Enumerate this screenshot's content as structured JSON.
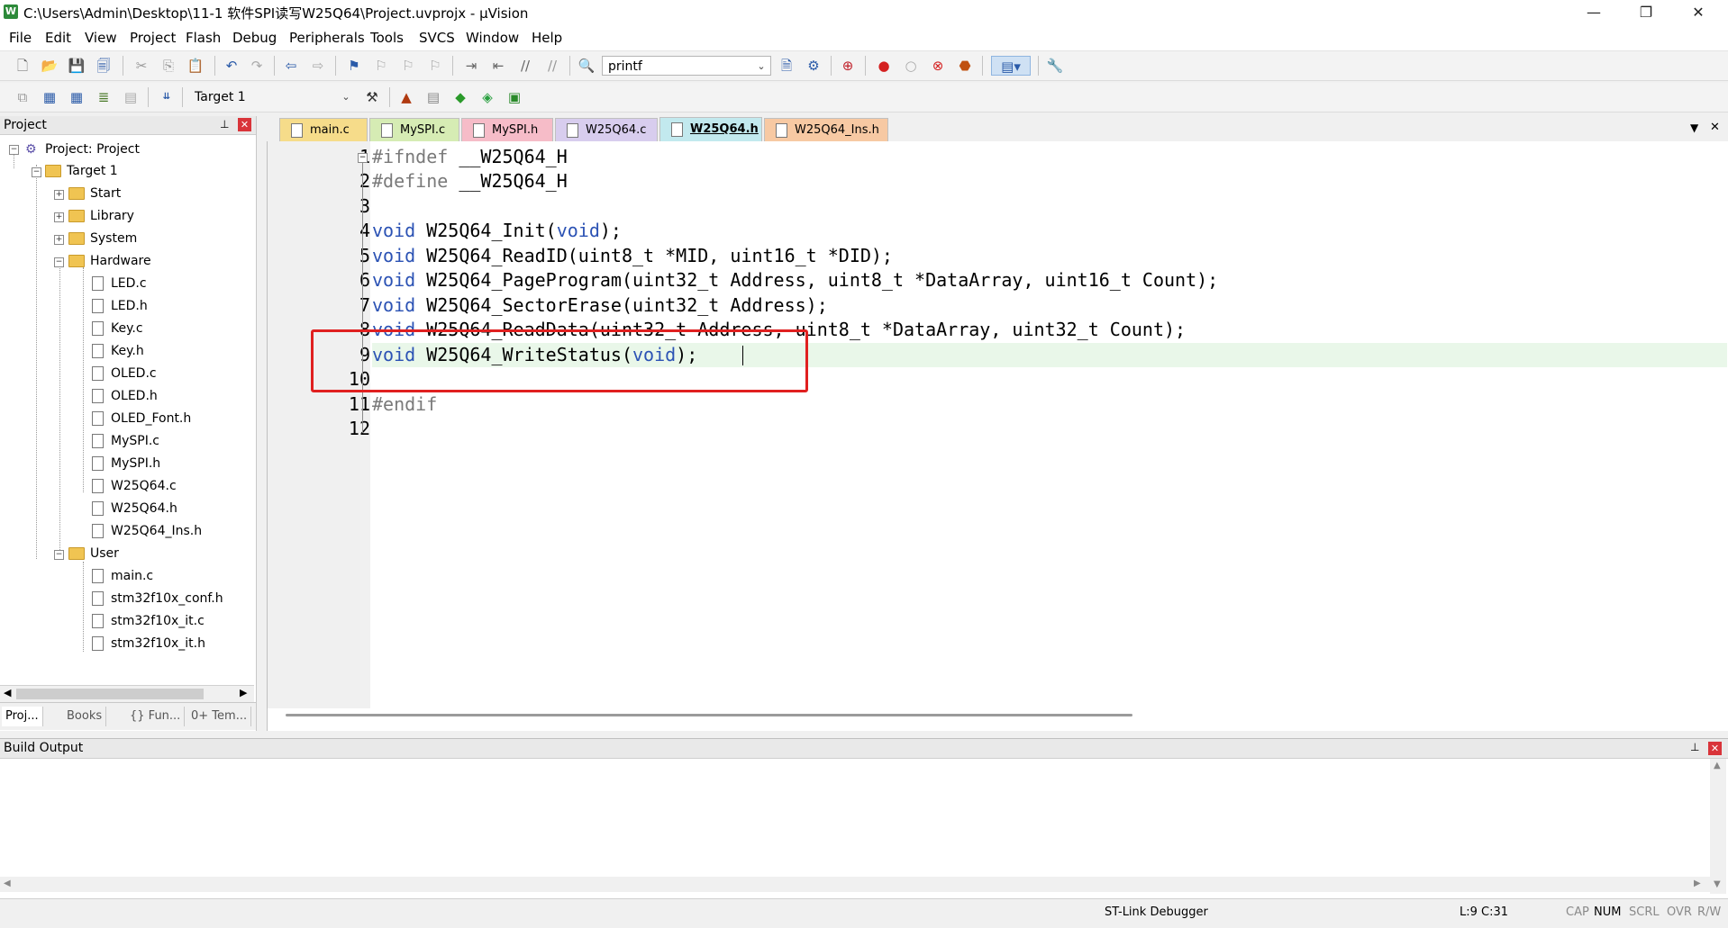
{
  "window": {
    "title": "C:\\Users\\Admin\\Desktop\\11-1 软件SPI读写W25Q64\\Project.uvprojx - µVision",
    "icon_letter": "W",
    "minimize": "—",
    "restore": "❐",
    "close": "✕"
  },
  "menu": [
    "File",
    "Edit",
    "View",
    "Project",
    "Flash",
    "Debug",
    "Peripherals",
    "Tools",
    "SVCS",
    "Window",
    "Help"
  ],
  "toolbar": {
    "find_value": "printf",
    "target_value": "Target 1"
  },
  "project_panel": {
    "title": "Project",
    "pin": "⊥",
    "close": "✕",
    "root": "Project: Project",
    "target": "Target 1",
    "groups": [
      "Start",
      "Library",
      "System",
      "Hardware",
      "User"
    ],
    "hardware_files": [
      "LED.c",
      "LED.h",
      "Key.c",
      "Key.h",
      "OLED.c",
      "OLED.h",
      "OLED_Font.h",
      "MySPI.c",
      "MySPI.h",
      "W25Q64.c",
      "W25Q64.h",
      "W25Q64_Ins.h"
    ],
    "user_files": [
      "main.c",
      "stm32f10x_conf.h",
      "stm32f10x_it.c",
      "stm32f10x_it.h"
    ],
    "bottom_tabs": [
      "Proj...",
      "Books",
      "{} Fun...",
      "0+ Tem..."
    ]
  },
  "editor": {
    "tabs": [
      {
        "label": "main.c",
        "color": "#f6dc8a"
      },
      {
        "label": "MySPI.c",
        "color": "#d6ecb4"
      },
      {
        "label": "MySPI.h",
        "color": "#f6bcc8"
      },
      {
        "label": "W25Q64.c",
        "color": "#d8cdee"
      },
      {
        "label": "W25Q64.h",
        "color": "#c2e9ee"
      },
      {
        "label": "W25Q64_Ins.h",
        "color": "#f7c9a3"
      }
    ],
    "active_tab": "W25Q64.h",
    "line_numbers": [
      "1",
      "2",
      "3",
      "4",
      "5",
      "6",
      "7",
      "8",
      "9",
      "10",
      "11",
      "12"
    ],
    "lines": {
      "l1_pp": "#ifndef",
      "l1_rest": " __W25Q64_H",
      "l2_pp": "#define",
      "l2_rest": " __W25Q64_H",
      "l4_kw1": "void",
      "l4_mid": " W25Q64_Init(",
      "l4_kw2": "void",
      "l4_end": ");",
      "l5_kw1": "void",
      "l5_rest": " W25Q64_ReadID(uint8_t *MID, uint16_t *DID);",
      "l6_kw1": "void",
      "l6_rest": " W25Q64_PageProgram(uint32_t Address, uint8_t *DataArray, uint16_t Count);",
      "l7_kw1": "void",
      "l7_rest": " W25Q64_SectorErase(uint32_t Address);",
      "l8_kw1": "void",
      "l8_rest": " W25Q64_ReadData(uint32_t Address, uint8_t *DataArray, uint32_t Count);",
      "l9_kw1": "void",
      "l9_mid": " W25Q64_WriteStatus(",
      "l9_kw2": "void",
      "l9_end": ");",
      "l11_pp": "#endif"
    },
    "tabs_menu_arrow": "▼",
    "tabs_close": "✕"
  },
  "build_output": {
    "title": "Build Output",
    "pin": "⊥",
    "close": "✕"
  },
  "status": {
    "debugger": "ST-Link Debugger",
    "position": "L:9 C:31",
    "cap": "CAP",
    "num": "NUM",
    "scrl": "SCRL",
    "ovr": "OVR",
    "rw": "R/W"
  },
  "colors": {
    "highlight_box": "#e02020",
    "keyword": "#2b52b4",
    "preprocessor": "#7a7a7a",
    "current_line": "#e9f7e9"
  }
}
